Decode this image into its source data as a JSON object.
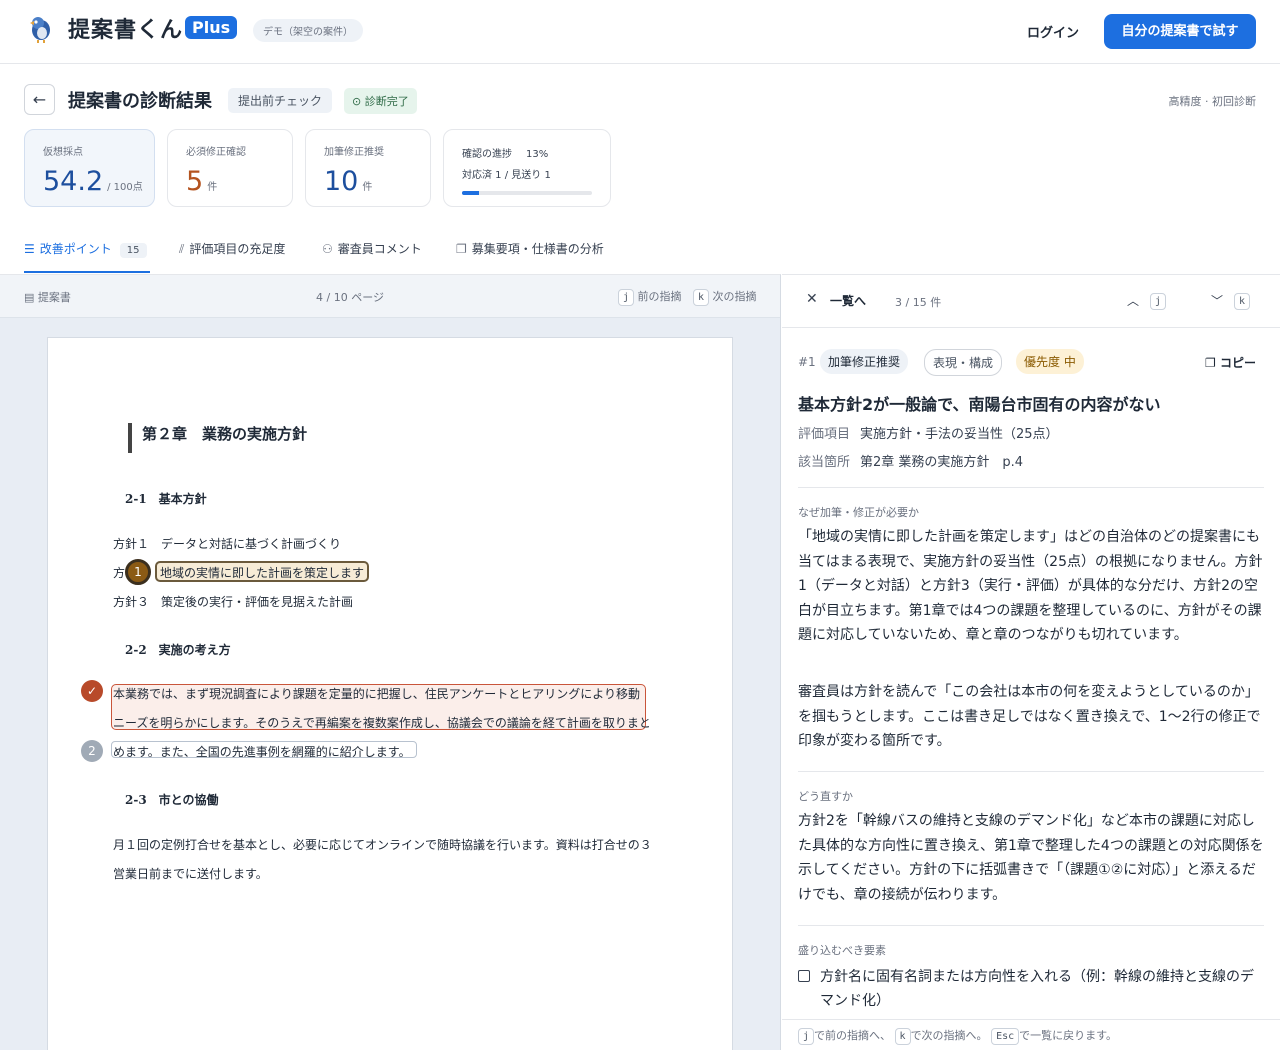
{
  "header": {
    "brand": "提案書くん",
    "plus": "Plus",
    "demo": "デモ（架空の案件）",
    "login": "ログイン",
    "try_button": "自分の提案書で試す"
  },
  "page": {
    "title": "提案書の診断結果",
    "tag_check": "提出前チェック",
    "tag_done": "診断完了",
    "mode": "高精度 · 初回診断"
  },
  "stats": {
    "score_label": "仮想採点",
    "score_value": "54.2",
    "score_unit": "/ 100点",
    "required_label": "必須修正確認",
    "required_value": "5",
    "required_unit": "件",
    "suggest_label": "加筆修正推奨",
    "suggest_value": "10",
    "suggest_unit": "件",
    "progress_label": "確認の進捗",
    "progress_pct": "13%",
    "progress_sub": "対応済 1 / 見送り 1",
    "progress_fraction": 0.13
  },
  "tabs": [
    {
      "label": "改善ポイント",
      "count": "15"
    },
    {
      "label": "評価項目の充足度"
    },
    {
      "label": "審査員コメント"
    },
    {
      "label": "募集要項・仕様書の分析"
    }
  ],
  "doc": {
    "label": "提案書",
    "page_indicator": "4 / 10 ページ",
    "prev_key": "j",
    "prev_label": "前の指摘",
    "next_key": "k",
    "next_label": "次の指摘",
    "chapter": "第２章　業務の実施方針",
    "sec1": "2-1　基本方針",
    "line1": "方針１　データと対話に基づく計画づくり",
    "line2_prefix": "方",
    "line2_hl": "地域の実情に即した計画を策定します",
    "line3": "方針３　策定後の実行・評価を見据えた計画",
    "sec2": "2-2　実施の考え方",
    "p1": "本業務では、まず現況調査により課題を定量的に把握し、住民アンケートとヒアリングにより移動",
    "p2": "ニーズを明らかにします。そのうえで再編案を複数案作成し、協議会での議論を経て計画を取りまと",
    "p3": "めます。また、全国の先進事例を網羅的に紹介します。",
    "sec3": "2-3　市との協働",
    "p4": "月１回の定例打合せを基本とし、必要に応じてオンラインで随時協議を行います。資料は打合せの３",
    "p5": "営業日前までに送付します。",
    "marker1": "1",
    "marker2": "2"
  },
  "detail": {
    "back": "一覧へ",
    "count": "3 / 15 件",
    "up_key": "j",
    "down_key": "k",
    "number": "#1",
    "pill1": "加筆修正推奨",
    "pill2": "表現・構成",
    "pill3": "優先度 中",
    "copy": "コピー",
    "title": "基本方針2が一般論で、南陽台市固有の内容がない",
    "meta1_label": "評価項目",
    "meta1_value": "実施方針・手法の妥当性（25点）",
    "meta2_label": "該当箇所",
    "meta2_value": "第2章 業務の実施方針　p.4",
    "why_label": "なぜ加筆・修正が必要か",
    "why_p1": "「地域の実情に即した計画を策定します」はどの自治体のどの提案書にも当てはまる表現で、実施方針の妥当性（25点）の根拠になりません。方針1（データと対話）と方針3（実行・評価）が具体的な分だけ、方針2の空白が目立ちます。第1章では4つの課題を整理しているのに、方針がその課題に対応していないため、章と章のつながりも切れています。",
    "why_p2": "審査員は方針を読んで「この会社は本市の何を変えようとしているのか」を掴もうとします。ここは書き足しではなく置き換えで、1〜2行の修正で印象が変わる箇所です。",
    "how_label": "どう直すか",
    "how_p": "方針2を「幹線バスの維持と支線のデマンド化」など本市の課題に対応した具体的な方向性に置き換え、第1章で整理した4つの課題との対応関係を示してください。方針の下に括弧書きで「（課題①②に対応）」と添えるだけでも、章の接続が伝わります。",
    "elements_label": "盛り込むべき要素",
    "element1": "方針名に固有名詞または方向性を入れる（例：幹線の維持と支線のデマンド化）"
  },
  "footer": {
    "j": "j",
    "t1": "で前の指摘へ、",
    "k": "k",
    "t2": "で次の指摘へ。",
    "esc": "Esc",
    "t3": "で一覧に戻ります。"
  }
}
